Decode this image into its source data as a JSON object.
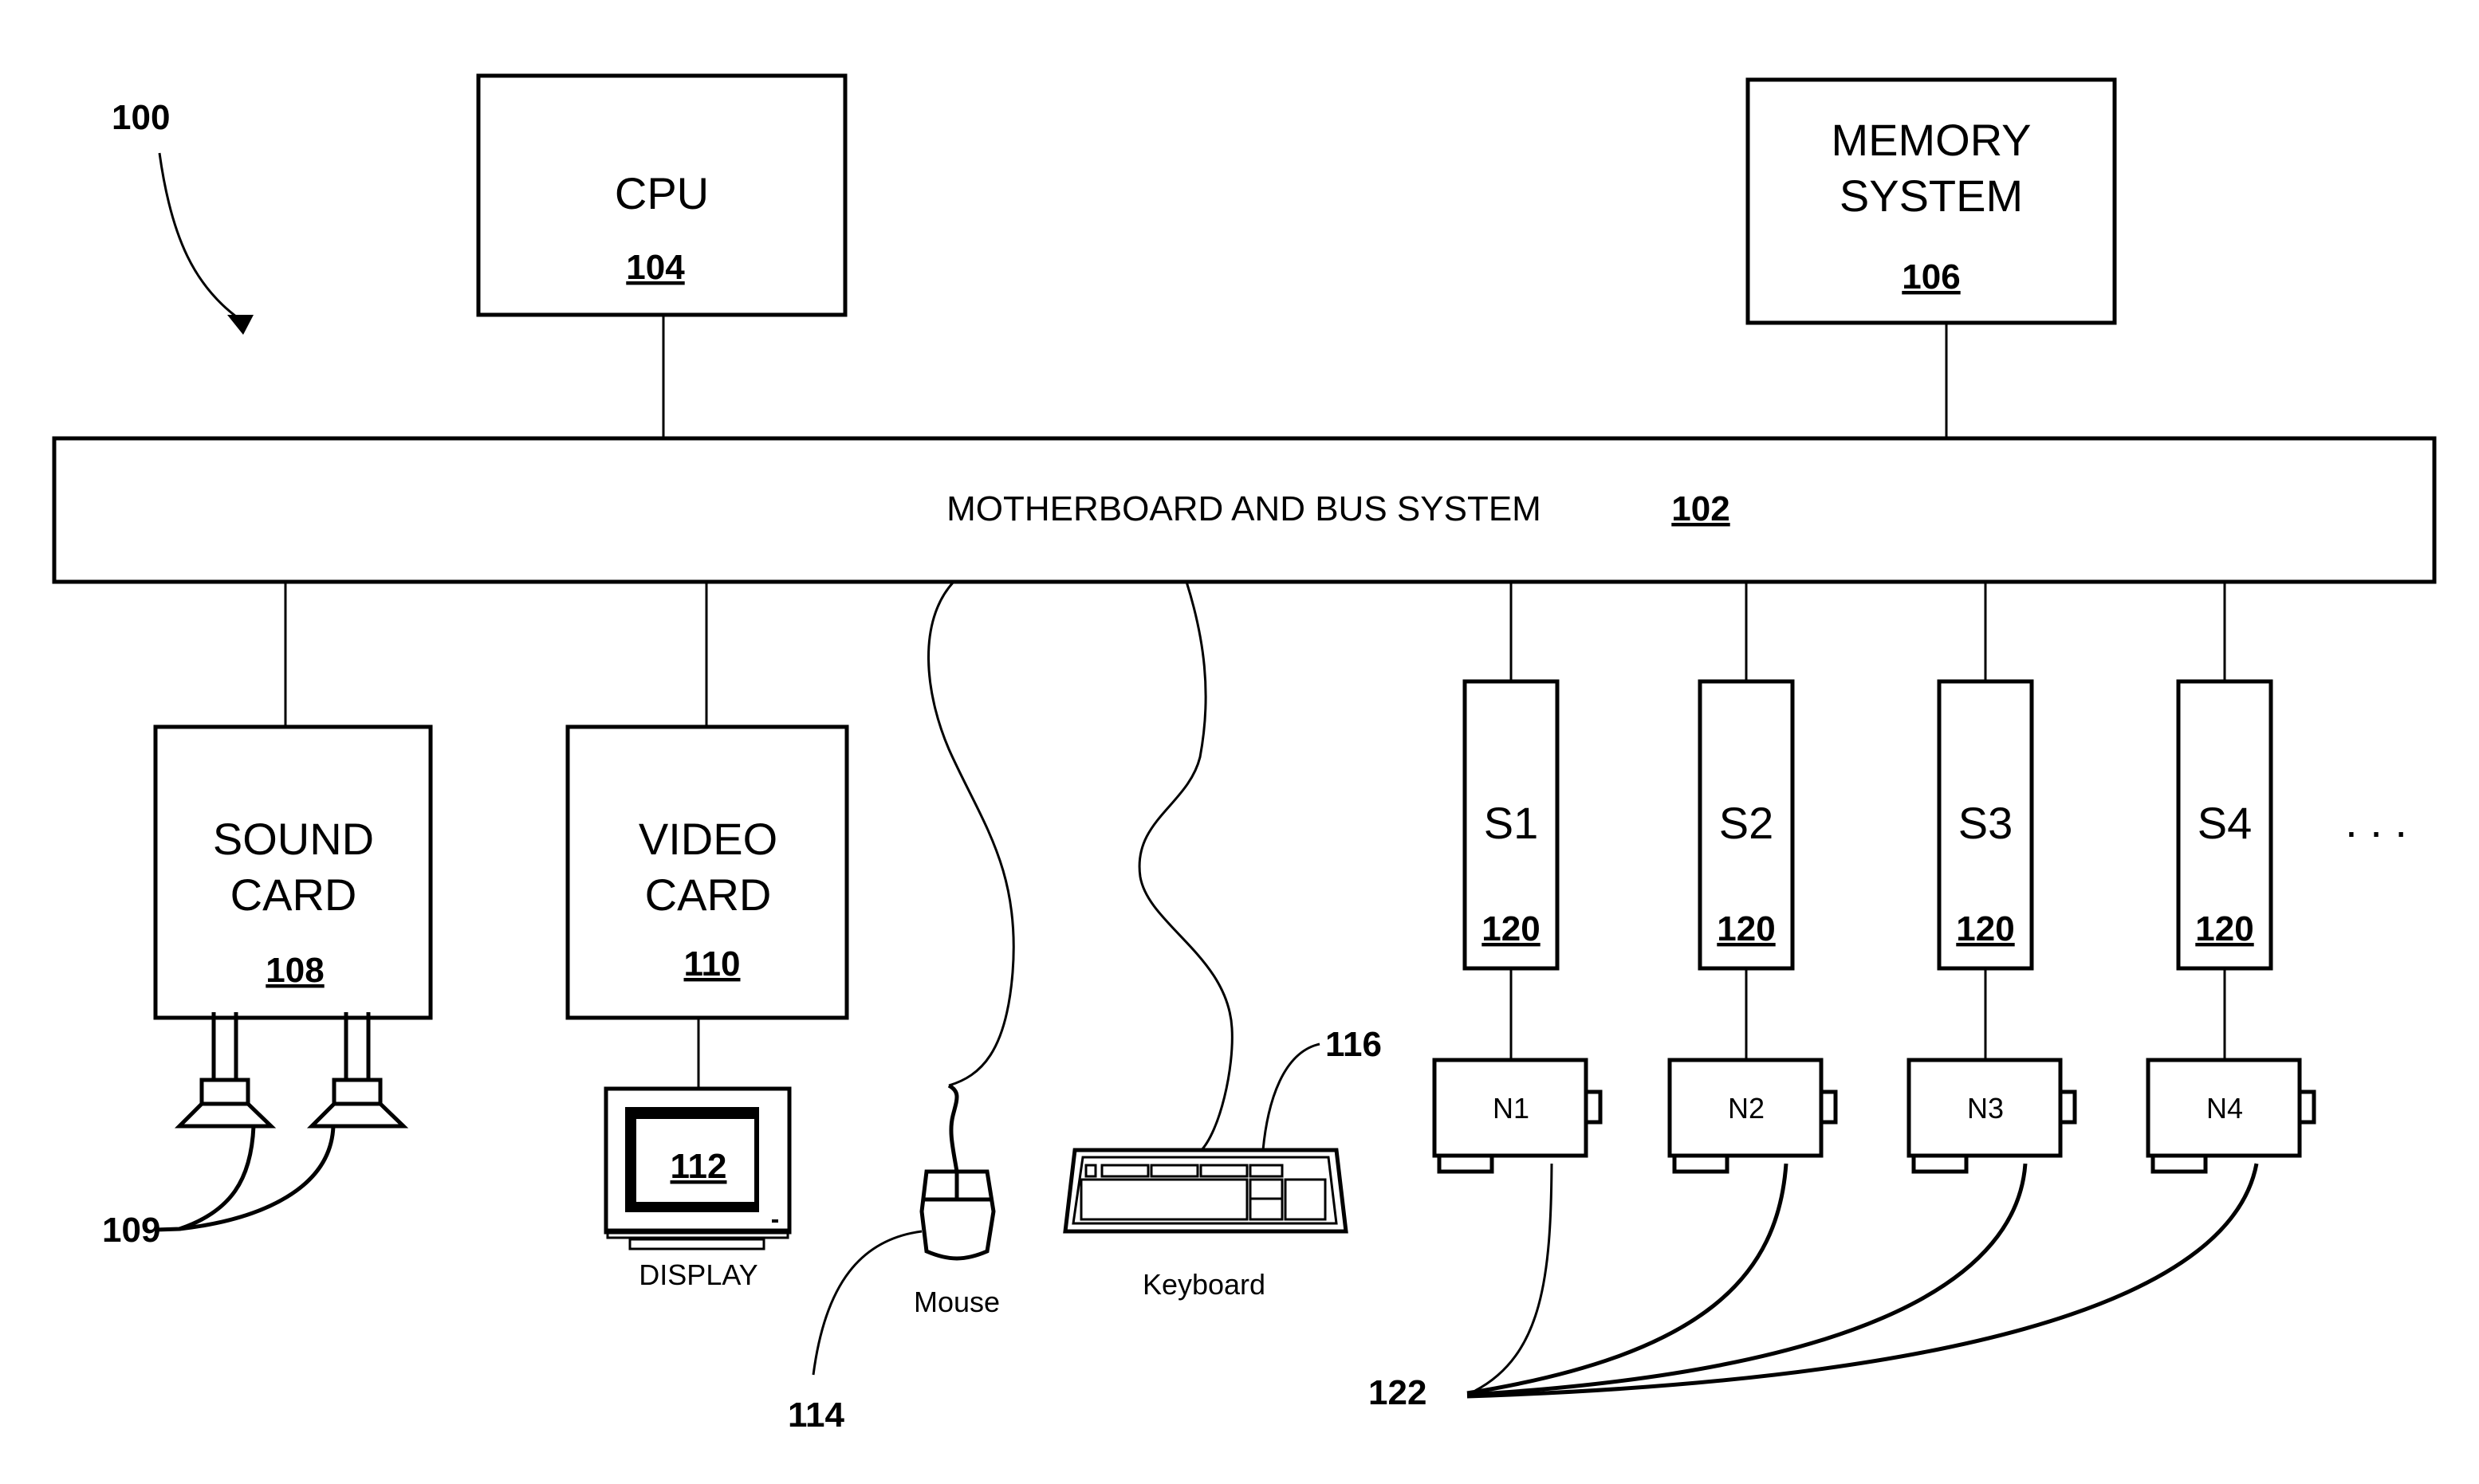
{
  "figure": {
    "ref": "100",
    "colors": {
      "ink": "#000000",
      "paper": "#ffffff"
    }
  },
  "cpu": {
    "label": "CPU",
    "ref": "104"
  },
  "memory": {
    "line1": "MEMORY",
    "line2": "SYSTEM",
    "ref": "106"
  },
  "bus": {
    "label": "MOTHERBOARD AND BUS SYSTEM",
    "ref": "102"
  },
  "sound_card": {
    "line1": "SOUND",
    "line2": "CARD",
    "ref": "108",
    "speakers_ref": "109"
  },
  "video_card": {
    "line1": "VIDEO",
    "line2": "CARD",
    "ref": "110"
  },
  "display": {
    "ref": "112",
    "label": "DISPLAY"
  },
  "mouse": {
    "label": "Mouse",
    "ref": "114"
  },
  "keyboard": {
    "label": "Keyboard",
    "ref": "116"
  },
  "slots": [
    {
      "label": "S1",
      "ref": "120"
    },
    {
      "label": "S2",
      "ref": "120"
    },
    {
      "label": "S3",
      "ref": "120"
    },
    {
      "label": "S4",
      "ref": "120"
    }
  ],
  "nodes": [
    {
      "label": "N1"
    },
    {
      "label": "N2"
    },
    {
      "label": "N3"
    },
    {
      "label": "N4"
    }
  ],
  "more_indicator": ". . .",
  "cables_ref": "122"
}
